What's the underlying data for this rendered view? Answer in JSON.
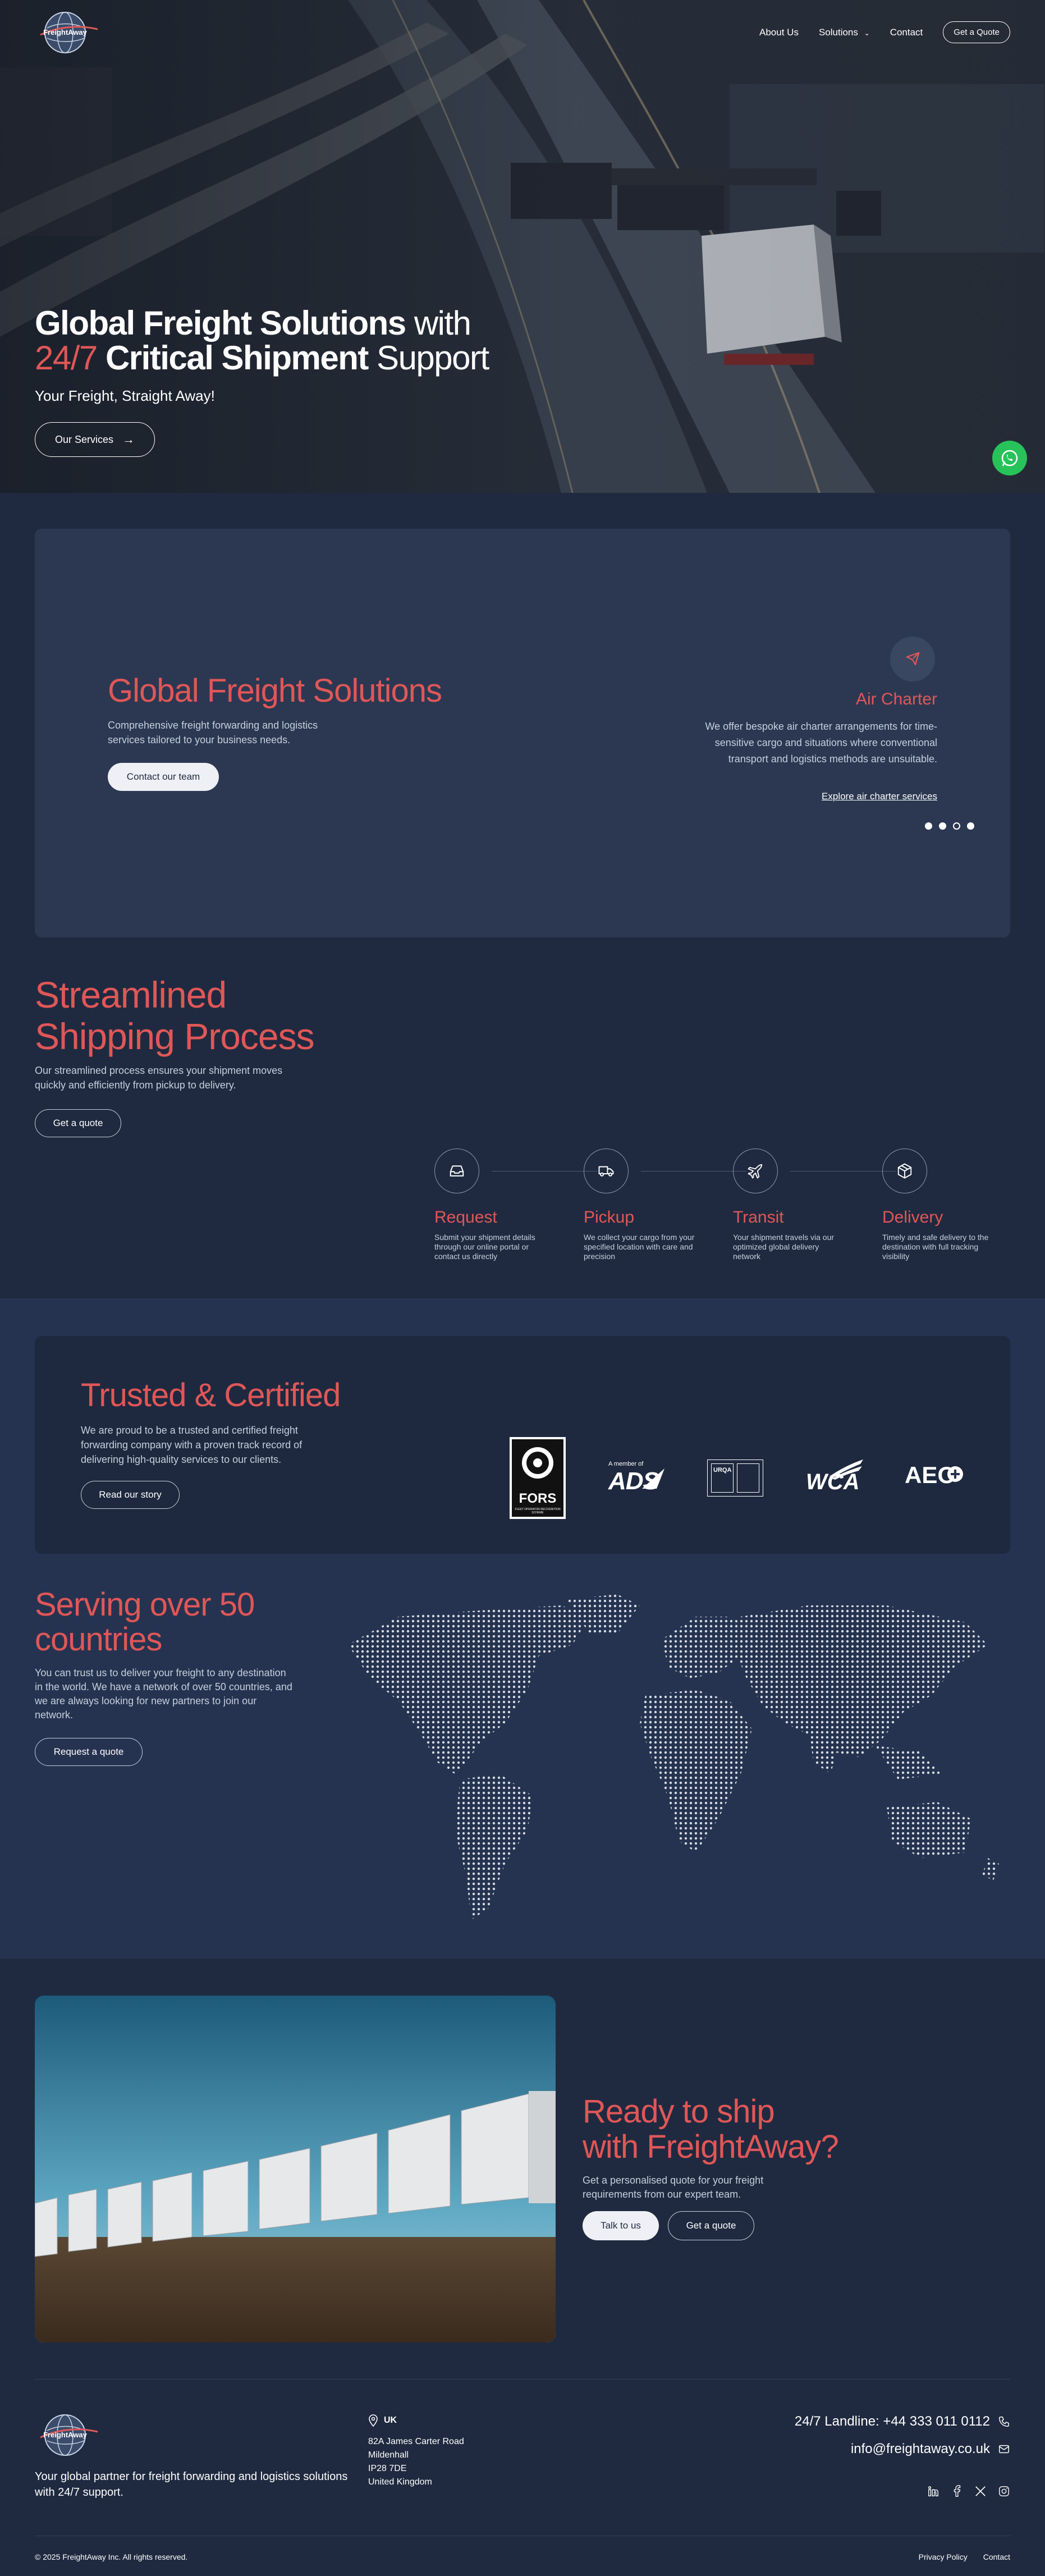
{
  "colors": {
    "accent": "#e05757",
    "background": "#1f2a40",
    "card": "#2c3852",
    "whatsapp": "#27c35a"
  },
  "header": {
    "logo_icon": "freightaway-globe-logo-icon",
    "nav": {
      "about": "About Us",
      "solutions": "Solutions",
      "contact": "Contact",
      "quote_button": "Get a Quote"
    }
  },
  "hero": {
    "title_line1_bold": "Global Freight Solutions",
    "title_line1_rest": " with",
    "title_line2_accent": "24/7",
    "title_line2_bold": " Critical Shipment",
    "title_line2_rest": " Support",
    "subtitle": "Your Freight, Straight Away!",
    "cta": "Our Services",
    "whatsapp_icon": "whatsapp-icon"
  },
  "services_card": {
    "title": "Global Freight Solutions",
    "description": "Comprehensive freight forwarding and logistics services tailored to your business needs.",
    "cta": "Contact our team",
    "active_service": {
      "icon": "airplane-icon",
      "title": "Air Charter",
      "description": "We offer bespoke air charter arrangements for time-sensitive cargo and situations where conventional transport and logistics methods are unsuitable.",
      "link": "Explore air charter services"
    },
    "carousel": {
      "slides": 4,
      "active_index": 2
    }
  },
  "process": {
    "title_line1": "Streamlined",
    "title_line2": "Shipping Process",
    "description": "Our streamlined process ensures your shipment moves quickly and efficiently from pickup to delivery.",
    "cta": "Get a quote",
    "steps": [
      {
        "icon": "inbox-icon",
        "title": "Request",
        "description": "Submit your shipment details through our online portal or contact us directly"
      },
      {
        "icon": "truck-icon",
        "title": "Pickup",
        "description": "We collect your cargo from your specified location with care and precision"
      },
      {
        "icon": "airplane-icon",
        "title": "Transit",
        "description": "Your shipment travels via our optimized global delivery network"
      },
      {
        "icon": "box-icon",
        "title": "Delivery",
        "description": "Timely and safe delivery to the destination with full tracking visibility"
      }
    ]
  },
  "certified": {
    "title": "Trusted & Certified",
    "description": "We are proud to be a trusted and certified freight forwarding company with a proven track record of delivering high-quality services to our clients.",
    "cta": "Read our story",
    "logos": {
      "fors": "FORS",
      "fors_sub": "FLEET OPERATOR RECOGNITION SCHEME",
      "ads_member": "A member of",
      "ads": "ADS",
      "urqa": "URQA",
      "wca": "WCA",
      "aeo": "AEO"
    }
  },
  "countries": {
    "title_line1": "Serving over 50",
    "title_line2": "countries",
    "description": "You can trust us to deliver your freight to any destination in the world. We have a network of over 50 countries, and we are always looking for new partners to join our network.",
    "cta": "Request a quote"
  },
  "ready": {
    "title_line1": "Ready to ship",
    "title_line2": "with FreightAway?",
    "description": "Get a personalised quote for your freight requirements from our expert team.",
    "primary_cta": "Talk to us",
    "secondary_cta": "Get a quote"
  },
  "footer": {
    "description": "Your global partner for freight forwarding and logistics solutions with 24/7 support.",
    "region": "UK",
    "address": [
      "82A James Carter Road",
      "Mildenhall",
      "IP28 7DE",
      "United Kingdom"
    ],
    "landline": "24/7 Landline: +44 333 011 0112",
    "email": "info@freightaway.co.uk",
    "socials": [
      "linkedin-icon",
      "facebook-icon",
      "x-icon",
      "instagram-icon"
    ],
    "copyright": "© 2025 FreightAway Inc. All rights reserved.",
    "privacy": "Privacy Policy",
    "contact": "Contact"
  }
}
